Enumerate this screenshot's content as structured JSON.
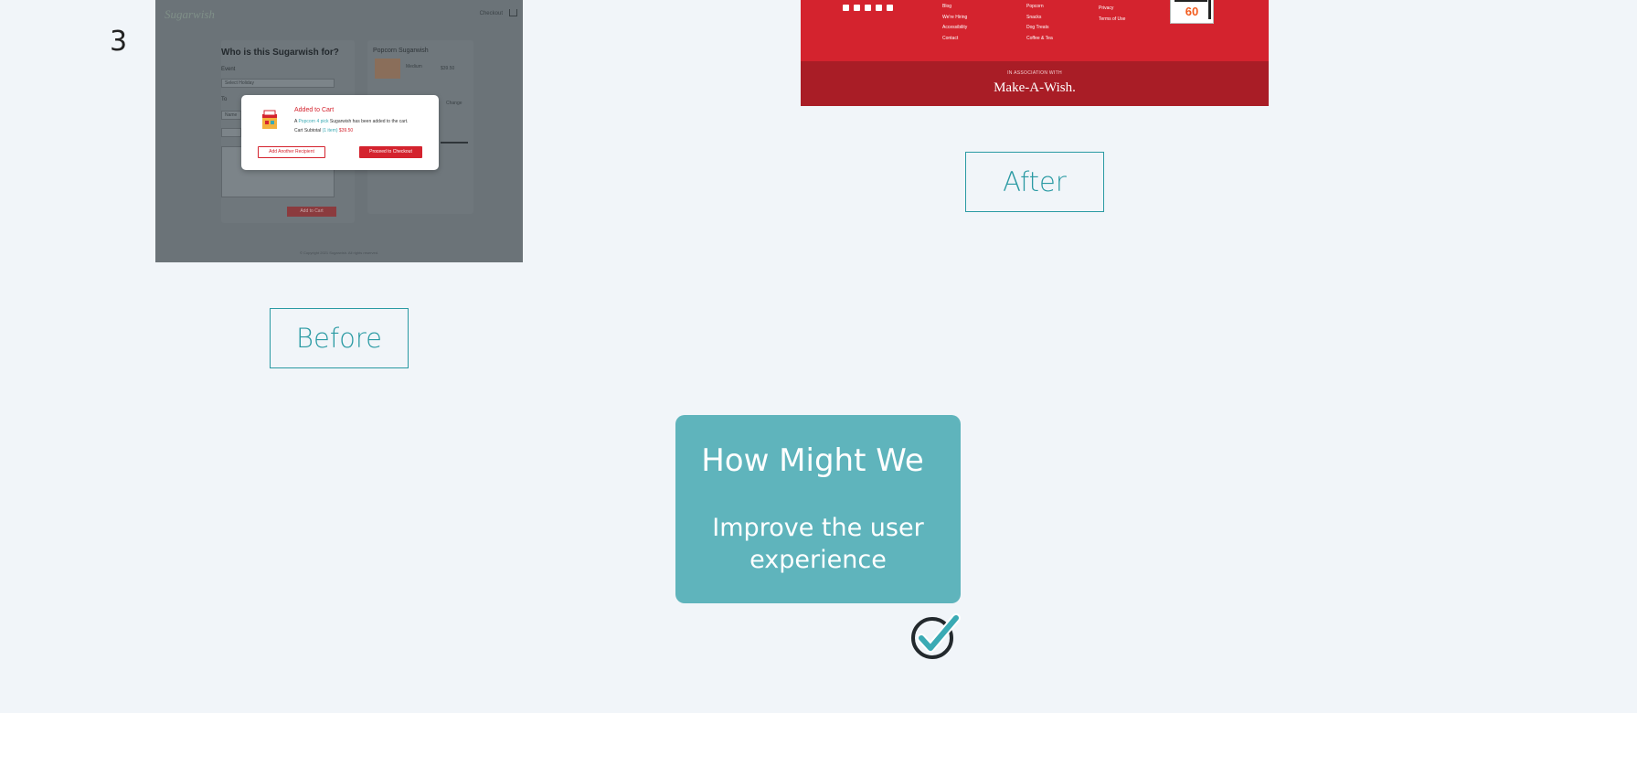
{
  "step": {
    "number": "3"
  },
  "before": {
    "label": "Before",
    "screenshot": {
      "logo": "Sugarwish",
      "nav_link": "Checkout",
      "form_title": "Who is this Sugarwish for?",
      "event_label": "Event",
      "event_value": "Select Holiday",
      "to_label": "To",
      "to_placeholder": "Name",
      "side_title": "Popcorn Sugarwish",
      "side_size": "Medium",
      "side_price": "$39.50",
      "side_link": "Change",
      "add_button": "Add to Cart",
      "footer_text": "© Copyright 2021 Sugarwish. All rights reserved.",
      "modal": {
        "title": "Added to Cart",
        "text_prefix": "A ",
        "text_highlight": "Popcorn 4 pick",
        "text_suffix": " Sugarwish has been added to the cart.",
        "subtotal_label": "Cart Subtotal ",
        "subtotal_items": "(1 item) ",
        "subtotal_price": "$39.50",
        "secondary_button": "Add Another Recipient",
        "primary_button": "Proceed to Checkout"
      }
    }
  },
  "after": {
    "label": "After",
    "screenshot": {
      "col1": [
        "Blog",
        "We're Hiring",
        "Accessibility",
        "Contact"
      ],
      "col2": [
        "Popcorn",
        "Snacks",
        "Dog Treats",
        "Coffee & Tea"
      ],
      "col3": [
        "Privacy",
        "Terms of Use"
      ],
      "badge_number": "60",
      "association_text": "IN ASSOCIATION WITH",
      "partner_logo": "Make-A-Wish."
    }
  },
  "hmw": {
    "title": "How Might We",
    "body": "Improve the user experience",
    "card_color": "#5fb4bc",
    "check_icon": "check-circle-icon"
  },
  "colors": {
    "accent": "#2a9aa3",
    "brand_red": "#d4232e",
    "background": "#f1f5f9"
  }
}
